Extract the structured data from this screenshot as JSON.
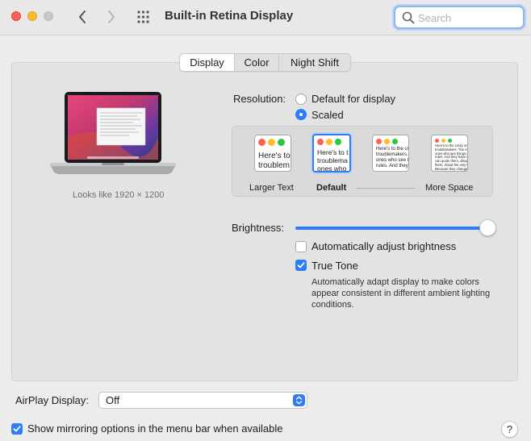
{
  "window": {
    "title": "Built-in Retina Display"
  },
  "search": {
    "placeholder": "Search",
    "value": ""
  },
  "tabs": [
    {
      "label": "Display",
      "active": true
    },
    {
      "label": "Color",
      "active": false
    },
    {
      "label": "Night Shift",
      "active": false
    }
  ],
  "display_preview": {
    "looks_like": "Looks like 1920 × 1200"
  },
  "resolution": {
    "label": "Resolution:",
    "options": [
      {
        "label": "Default for display",
        "selected": false
      },
      {
        "label": "Scaled",
        "selected": true
      }
    ]
  },
  "scaled_options": {
    "thumbnails": [
      {
        "text": "Here's to\ntroublem",
        "selected": false
      },
      {
        "text": "Here's to t\ntroublema\nones who",
        "selected": true
      },
      {
        "text": "Here's to the cr\ntroublemakers.\nones who see th\nrules. And they",
        "selected": false
      },
      {
        "text": "Here's to the crazy one\ntroublemakers. The rou\nones who see things dif\nrules. And they have no\ncan quote them, disagre\nthem. About the only th\nBecause they change t",
        "selected": false
      }
    ],
    "labels": {
      "left": "Larger Text",
      "default": "Default",
      "right": "More Space"
    }
  },
  "brightness": {
    "label": "Brightness:",
    "level": 0.96
  },
  "auto_brightness": {
    "label": "Automatically adjust brightness",
    "checked": false
  },
  "true_tone": {
    "label": "True Tone",
    "checked": true,
    "description": "Automatically adapt display to make colors appear consistent in different ambient lighting conditions."
  },
  "airplay": {
    "label": "AirPlay Display:",
    "value": "Off"
  },
  "mirroring": {
    "label": "Show mirroring options in the menu bar when available",
    "checked": true
  },
  "help": {
    "label": "?"
  },
  "colors": {
    "accent": "#2d7cf6",
    "close": "#fe5f57",
    "minimize": "#febc2e",
    "zoom_inactive": "#c8c8c8"
  },
  "icons": {
    "back": "chevron-left-icon",
    "forward": "chevron-right-icon",
    "grid": "grid-icon",
    "search": "search-icon",
    "stepper": "up-down-chevron-icon",
    "check": "checkmark-icon"
  }
}
